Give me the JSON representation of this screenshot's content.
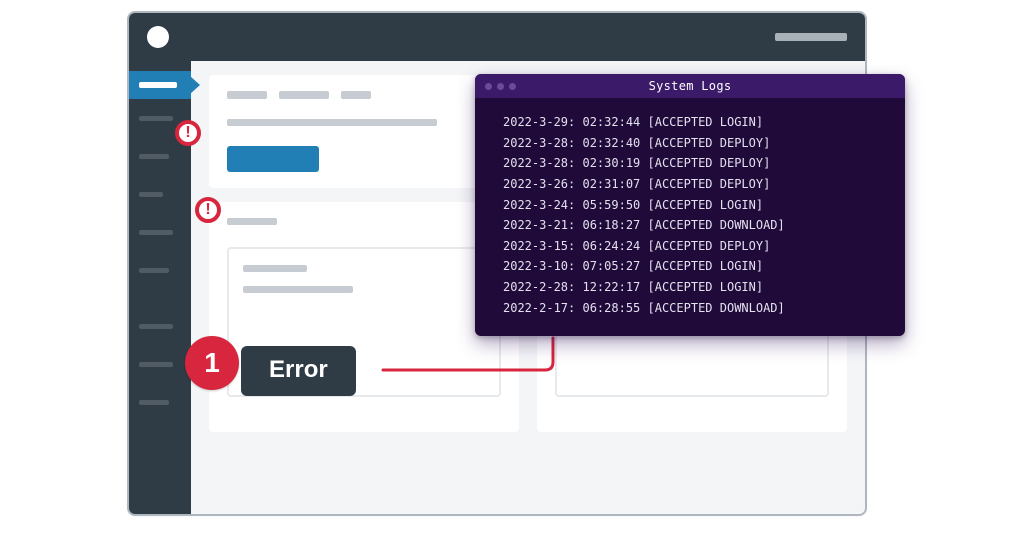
{
  "titlebar": {},
  "terminal": {
    "title": "System Logs",
    "logs": [
      "2022-3-29: 02:32:44 [ACCEPTED LOGIN]",
      "2022-3-28: 02:32:40 [ACCEPTED DEPLOY]",
      "2022-3-28: 02:30:19 [ACCEPTED DEPLOY]",
      "2022-3-26: 02:31:07 [ACCEPTED DEPLOY]",
      "2022-3-24: 05:59:50 [ACCEPTED LOGIN]",
      "2022-3-21: 06:18:27 [ACCEPTED DOWNLOAD]",
      "2022-3-15: 06:24:24 [ACCEPTED DEPLOY]",
      "2022-3-10: 07:05:27 [ACCEPTED LOGIN]",
      "2022-2-28: 12:22:17 [ACCEPTED LOGIN]",
      "2022-2-17: 06:28:55 [ACCEPTED DOWNLOAD]"
    ]
  },
  "alerts": {
    "icon_glyph": "!"
  },
  "callout": {
    "step_number": "1",
    "label": "Error"
  },
  "colors": {
    "accent_red": "#d7263d",
    "accent_blue": "#227fb5",
    "terminal_bg": "#1f0a3a",
    "chrome_dark": "#2f3b45"
  }
}
